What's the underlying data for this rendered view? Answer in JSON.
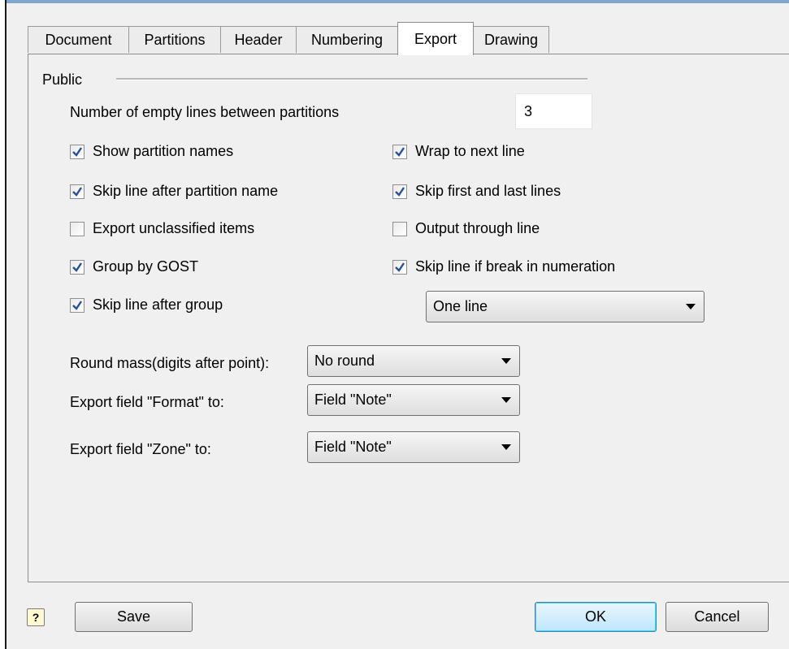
{
  "tabs": [
    "Document",
    "Partitions",
    "Header",
    "Numbering",
    "Export",
    "Drawing"
  ],
  "group": {
    "label": "Public"
  },
  "empty_lines": {
    "label": "Number of empty lines between partitions",
    "value": "3"
  },
  "checkboxes_left": [
    {
      "label": "Show partition names",
      "checked": true
    },
    {
      "label": "Skip line after partition name",
      "checked": true
    },
    {
      "label": "Export unclassified items",
      "checked": false
    },
    {
      "label": "Group by GOST",
      "checked": true
    },
    {
      "label": "Skip line after group",
      "checked": true
    }
  ],
  "checkboxes_right": [
    {
      "label": "Wrap to next line",
      "checked": true
    },
    {
      "label": "Skip first and last lines",
      "checked": true
    },
    {
      "label": "Output through line",
      "checked": false
    },
    {
      "label": "Skip line if break in numeration",
      "checked": true
    }
  ],
  "numeration_select": {
    "value": "One line"
  },
  "round_mass": {
    "label": "Round mass(digits after point):",
    "value": "No round"
  },
  "export_format": {
    "label": "Export field \"Format\" to:",
    "value": "Field \"Note\""
  },
  "export_zone": {
    "label": "Export field \"Zone\" to:",
    "value": "Field \"Note\""
  },
  "buttons": {
    "help": "?",
    "save": "Save",
    "ok": "OK",
    "cancel": "Cancel"
  }
}
